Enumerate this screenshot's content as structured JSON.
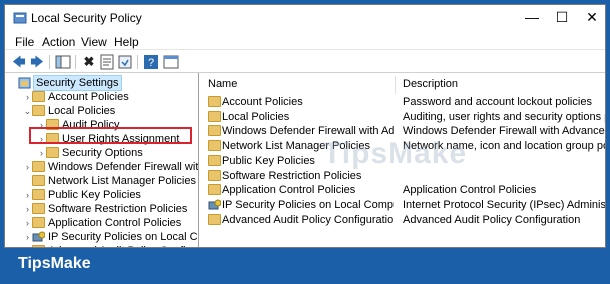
{
  "window": {
    "title": "Local Security Policy",
    "minimize": "—",
    "maximize": "☐",
    "close": "✕"
  },
  "menu": [
    "File",
    "Action",
    "View",
    "Help"
  ],
  "tree": [
    {
      "label": "Security Settings",
      "name": "tree-security-settings",
      "indent": 0,
      "expander": "",
      "selected": true,
      "icon": "security-settings-icon"
    },
    {
      "label": "Account Policies",
      "name": "tree-account-policies",
      "indent": 1,
      "expander": "›",
      "icon": "folder-icon"
    },
    {
      "label": "Local Policies",
      "name": "tree-local-policies",
      "indent": 1,
      "expander": "⌄",
      "icon": "folder-icon"
    },
    {
      "label": "Audit Policy",
      "name": "tree-audit-policy",
      "indent": 2,
      "expander": "›",
      "icon": "folder-icon"
    },
    {
      "label": "User Rights Assignment",
      "name": "tree-user-rights-assignment",
      "indent": 2,
      "expander": "›",
      "icon": "folder-icon"
    },
    {
      "label": "Security Options",
      "name": "tree-security-options",
      "indent": 2,
      "expander": "›",
      "icon": "folder-icon"
    },
    {
      "label": "Windows Defender Firewall with Adva",
      "name": "tree-windows-defender-firewall",
      "indent": 1,
      "expander": "›",
      "icon": "folder-icon"
    },
    {
      "label": "Network List Manager Policies",
      "name": "tree-network-list-manager",
      "indent": 1,
      "expander": "",
      "icon": "folder-icon"
    },
    {
      "label": "Public Key Policies",
      "name": "tree-public-key-policies",
      "indent": 1,
      "expander": "›",
      "icon": "folder-icon"
    },
    {
      "label": "Software Restriction Policies",
      "name": "tree-software-restriction",
      "indent": 1,
      "expander": "›",
      "icon": "folder-icon"
    },
    {
      "label": "Application Control Policies",
      "name": "tree-application-control",
      "indent": 1,
      "expander": "›",
      "icon": "folder-icon"
    },
    {
      "label": "IP Security Policies on Local Compute",
      "name": "tree-ip-security",
      "indent": 1,
      "expander": "›",
      "icon": "ip-security-icon"
    },
    {
      "label": "Advanced Audit Policy Configuration",
      "name": "tree-advanced-audit",
      "indent": 1,
      "expander": "›",
      "icon": "folder-icon"
    }
  ],
  "list": {
    "columns": {
      "name": "Name",
      "description": "Description"
    },
    "rows": [
      {
        "name": "Account Policies",
        "description": "Password and account lockout policies",
        "icon": "folder-icon"
      },
      {
        "name": "Local Policies",
        "description": "Auditing, user rights and security options polici...",
        "icon": "folder-icon"
      },
      {
        "name": "Windows Defender Firewall with Advanc...",
        "description": "Windows Defender Firewall with Advanced Sec...",
        "icon": "folder-icon"
      },
      {
        "name": "Network List Manager Policies",
        "description": "Network name, icon and location group policies.",
        "icon": "folder-icon"
      },
      {
        "name": "Public Key Policies",
        "description": "",
        "icon": "folder-icon"
      },
      {
        "name": "Software Restriction Policies",
        "description": "",
        "icon": "folder-icon"
      },
      {
        "name": "Application Control Policies",
        "description": "Application Control Policies",
        "icon": "folder-icon"
      },
      {
        "name": "IP Security Policies on Local Computer",
        "description": "Internet Protocol Security (IPsec) Administratio...",
        "icon": "ip-security-icon"
      },
      {
        "name": "Advanced Audit Policy Configuration",
        "description": "Advanced Audit Policy Configuration",
        "icon": "folder-icon"
      }
    ]
  },
  "watermark": "TipsMake",
  "brand": "TipsMake",
  "colors": {
    "highlight_box": "#d9232f",
    "background": "#1a5fa8",
    "folder": "#e9c46a"
  }
}
